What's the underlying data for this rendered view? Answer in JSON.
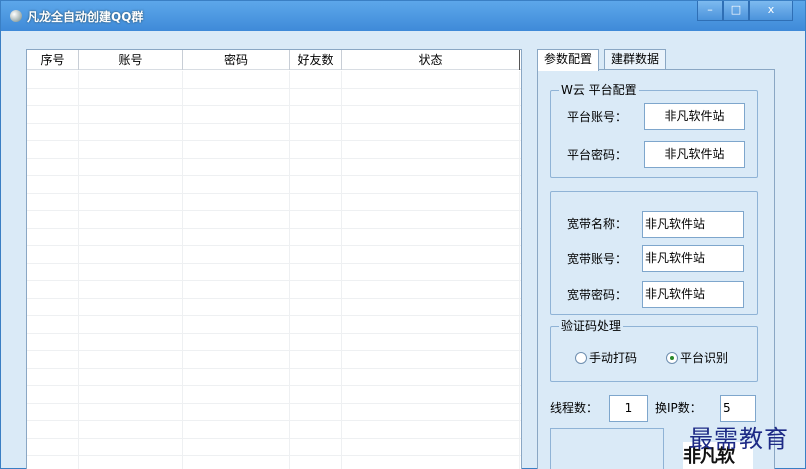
{
  "window": {
    "title": "凡龙全自动创建QQ群",
    "min_label": "–",
    "max_label": "□",
    "close_label": "x"
  },
  "list": {
    "columns": [
      "序号",
      "账号",
      "密码",
      "好友数",
      "状态"
    ],
    "row_count": 23
  },
  "tabs": [
    {
      "label": "参数配置",
      "active": true
    },
    {
      "label": "建群数据",
      "active": false
    }
  ],
  "platform": {
    "group_title": "W云 平台配置",
    "account_label": "平台账号：",
    "account_value": "非凡软件站",
    "password_label": "平台密码：",
    "password_value": "非凡软件站"
  },
  "broadband": {
    "name_label": "宽带名称：",
    "name_value": "非凡软件站",
    "account_label": "宽带账号：",
    "account_value": "非凡软件站",
    "password_label": "宽带密码：",
    "password_value": "非凡软件站"
  },
  "captcha": {
    "group_title": "验证码处理",
    "option_manual": "手动打码",
    "option_platform": "平台识别",
    "selected": "平台识别",
    "image_text": "非凡软"
  },
  "threads": {
    "label": "线程数：",
    "value": "1",
    "ip_label": "换IP数：",
    "ip_value": "5"
  },
  "watermark": "最需教育"
}
